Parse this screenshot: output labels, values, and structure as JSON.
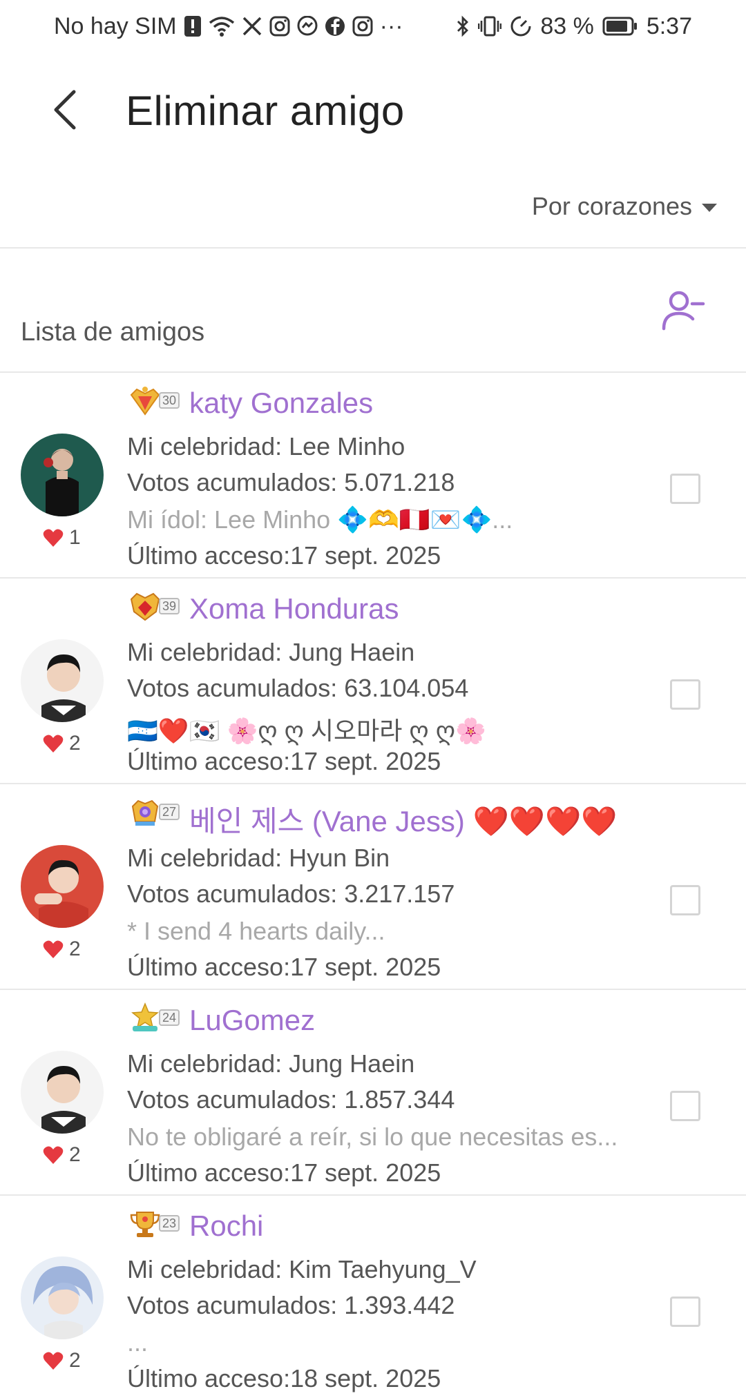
{
  "status_bar": {
    "carrier": "No hay SIM",
    "more": "···",
    "battery": "83 %",
    "time": "5:37"
  },
  "header": {
    "title": "Eliminar amigo"
  },
  "sort": {
    "label": "Por corazones"
  },
  "list": {
    "title": "Lista de amigos"
  },
  "colors": {
    "accent": "#a070d0",
    "heart": "#e53940",
    "divider": "#e8e8e8"
  },
  "friends": [
    {
      "level": "30",
      "name": "katy  Gonzales",
      "celebrity": "Mi celebridad: Lee Minho",
      "votes": "Votos acumulados: 5.071.218",
      "bio": "Mi ídol: Lee Minho  💠🫶🇵🇪💌💠...",
      "last_access": "Último acceso:17 sept. 2025",
      "hearts": "1"
    },
    {
      "level": "39",
      "name": "Xoma Honduras",
      "celebrity": "Mi celebridad: Jung Haein",
      "votes": "Votos acumulados: 63.104.054",
      "bio": "🇭🇳❤️🇰🇷 🌸ღ ღ 시오마라 ღ ღ🌸",
      "last_access": "Último acceso:17 sept. 2025",
      "hearts": "2"
    },
    {
      "level": "27",
      "name": "베인 제스 (Vane Jess) ❤️❤️❤️❤️",
      "celebrity": "Mi celebridad: Hyun Bin",
      "votes": "Votos acumulados: 3.217.157",
      "bio": "* I send 4 hearts daily...",
      "last_access": "Último acceso:17 sept. 2025",
      "hearts": "2"
    },
    {
      "level": "24",
      "name": "LuGomez",
      "celebrity": "Mi celebridad: Jung Haein",
      "votes": "Votos acumulados: 1.857.344",
      "bio": "No te obligaré a reír, si lo que necesitas es...",
      "last_access": "Último acceso:17 sept. 2025",
      "hearts": "2"
    },
    {
      "level": "23",
      "name": "Rochi",
      "celebrity": "Mi celebridad: Kim Taehyung_V",
      "votes": "Votos acumulados: 1.393.442",
      "bio": "...",
      "last_access": "Último acceso:18 sept. 2025",
      "hearts": "2"
    }
  ]
}
